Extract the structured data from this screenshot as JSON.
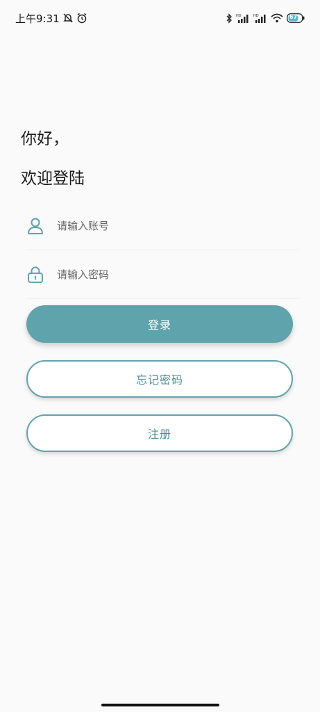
{
  "status_bar": {
    "time": "上午9:31",
    "battery": "67",
    "network_label": "HD",
    "icons": [
      "mute-icon",
      "alarm-icon",
      "bluetooth-icon",
      "signal-icon",
      "wifi-icon",
      "battery-icon"
    ]
  },
  "greeting": {
    "line1": "你好，",
    "line2": "欢迎登陆"
  },
  "form": {
    "account_placeholder": "请输入账号",
    "password_placeholder": "请输入密码"
  },
  "buttons": {
    "login": "登录",
    "forgot": "忘记密码",
    "register": "注册"
  },
  "colors": {
    "accent": "#5fa3ac",
    "accent_text": "#4e8d96",
    "background": "#fafafa"
  }
}
